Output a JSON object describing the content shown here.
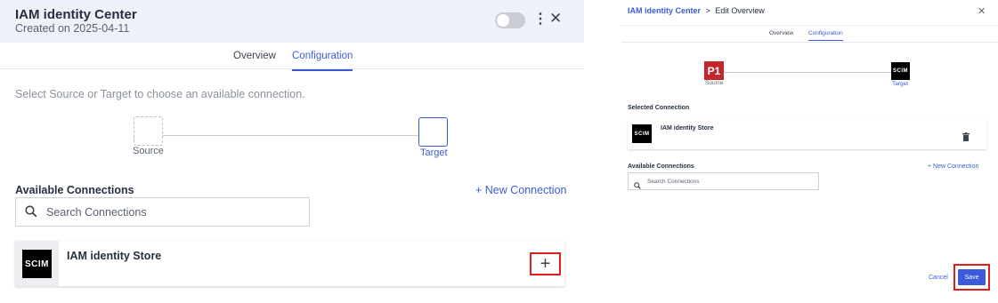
{
  "left": {
    "title": "IAM identity Center",
    "subtitle": "Created on 2025-04-11",
    "tabs": [
      "Overview",
      "Configuration"
    ],
    "active_tab": "Configuration",
    "help_text": "Select Source or Target to choose an available connection.",
    "source_label": "Source",
    "target_label": "Target",
    "available_heading": "Available Connections",
    "new_connection": "+ New Connection",
    "search_placeholder": "Search Connections",
    "connection": {
      "logo_text": "SCIM",
      "name": "IAM identity Store",
      "add_icon": "plus-icon"
    }
  },
  "right": {
    "breadcrumb_root": "IAM identity Center",
    "breadcrumb_sep": ">",
    "breadcrumb_current": "Edit Overview",
    "tabs": [
      "Overview",
      "Configuration"
    ],
    "active_tab": "Configuration",
    "source_logo": "P1",
    "source_label": "Source",
    "target_logo": "SCIM",
    "target_label": "Target",
    "selected_heading": "Selected Connection",
    "selected_connection": {
      "logo_text": "SCIM",
      "name": "IAM identity Store",
      "remove_icon": "trash-icon"
    },
    "available_heading": "Available Connections",
    "new_connection": "+ New Connection",
    "search_placeholder": "Search Connections",
    "cancel_label": "Cancel",
    "save_label": "Save"
  },
  "colors": {
    "accent": "#3b5bdb",
    "highlight": "#e02020",
    "source_brand": "#c4262e"
  }
}
